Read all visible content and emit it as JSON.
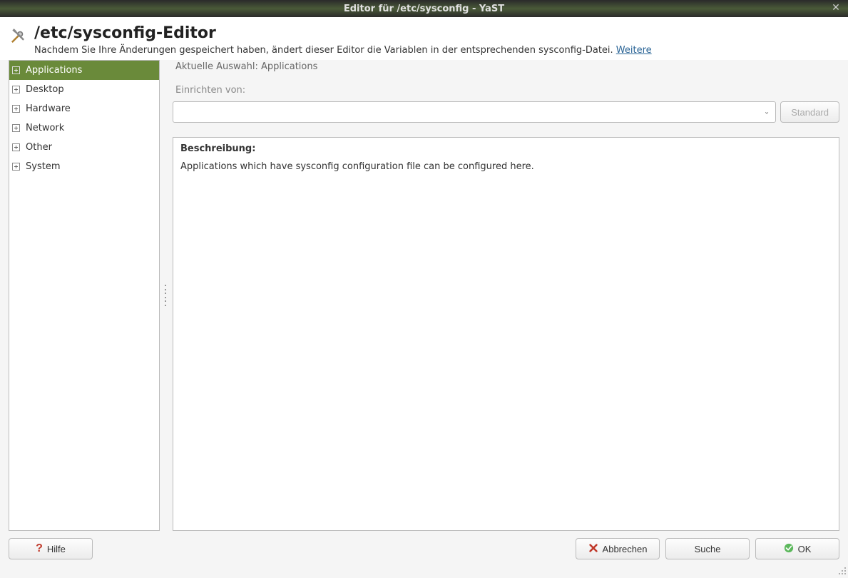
{
  "titlebar": {
    "title": "Editor für /etc/sysconfig - YaST"
  },
  "header": {
    "title": "/etc/sysconfig-Editor",
    "subtitle_prefix": "Nachdem Sie Ihre Änderungen gespeichert haben, ändert dieser Editor die Variablen in der entsprechenden sysconfig-Datei. ",
    "more_link": "Weitere"
  },
  "tree": {
    "items": [
      {
        "label": "Applications",
        "selected": true
      },
      {
        "label": "Desktop",
        "selected": false
      },
      {
        "label": "Hardware",
        "selected": false
      },
      {
        "label": "Network",
        "selected": false
      },
      {
        "label": "Other",
        "selected": false
      },
      {
        "label": "System",
        "selected": false
      }
    ]
  },
  "detail": {
    "selection_label": "Aktuelle Auswahl: Applications",
    "setup_label": "Einrichten von:",
    "combo_value": "",
    "standard_button": "Standard",
    "description_heading": "Beschreibung:",
    "description_text": "Applications which have sysconfig configuration file can be configured here."
  },
  "footer": {
    "help": "Hilfe",
    "cancel": "Abbrechen",
    "search": "Suche",
    "ok": "OK"
  }
}
